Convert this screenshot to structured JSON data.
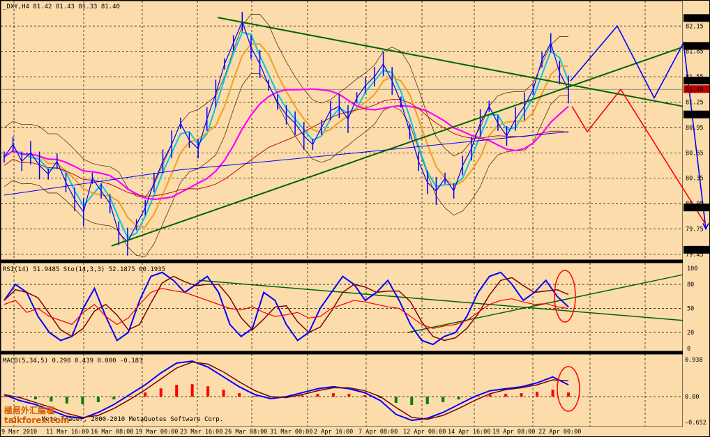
{
  "colors": {
    "background": "#fbdcaa",
    "frame": "#000000",
    "grid": "#000000",
    "price_line": "#0000ff",
    "ma_fast": "#00c8e0",
    "ma_mid": "#f0a020",
    "ma_slow": "#ff00ff",
    "ma_long": "#c01010",
    "ma_longest": "#0000ff",
    "bands": "#5a3010",
    "trend": "#006400",
    "forecast_blue": "#0000ff",
    "forecast_red": "#ff0000",
    "rsi": "#ff0000",
    "stoch_main": "#0000ff",
    "stoch_signal": "#800000",
    "macd_pos": "#ff0000",
    "macd_neg": "#008000",
    "ellipse": "#ff0000",
    "tag_bg": "#000000",
    "tag_fg": "#ffffff"
  },
  "main_header": "_DXY,H4 81.42 81.43 81.33 81.40",
  "rsi_header": "RSI(14) 51.9485  Sto(14,3,3) 52.1875 60.1935",
  "macd_header": "MACD(5,34,5) 0.298 0.439 0.000 -0.183",
  "overlay_text_1": "Meta Trader, 2000-2010 MetaQuotes Software Corp.",
  "watermark_line1": "極易外汇論壇",
  "watermark_line2": "taikforex.com",
  "x_labels": [
    "9 Mar 2010",
    "11 Mar 16:00",
    "16 Mar 08:00",
    "19 Mar 00:00",
    "23 Mar 16:00",
    "26 Mar 08:00",
    "31 Mar 00:00",
    "2 Apr 16:00",
    "7 Apr 08:00",
    "12 Apr 00:00",
    "14 Apr 16:00",
    "19 Apr 08:00",
    "22 Apr 00:00"
  ],
  "price_axis": {
    "labels": [
      "82.15",
      "81.85",
      "81.55",
      "81.25",
      "80.95",
      "80.65",
      "80.35",
      "80.05",
      "79.75",
      "79.45"
    ],
    "tags_dark": [
      "82.24",
      "81.91",
      "81.50",
      "81.10",
      "80.00",
      "79.50"
    ],
    "tag_red": "81.40",
    "ylim": [
      79.4,
      82.35
    ]
  },
  "rsi_axis": {
    "labels": [
      "100",
      "80",
      "50",
      "20",
      "0"
    ],
    "ylim": [
      0,
      100
    ]
  },
  "macd_axis": {
    "labels": [
      "0.938",
      "0.00",
      "-0.652"
    ],
    "ylim": [
      -0.652,
      0.938
    ]
  },
  "chart_data": [
    {
      "type": "candlestick",
      "title": "_DXY,H4 81.42 81.43 81.33 81.40",
      "symbol": "_DXY",
      "timeframe": "H4",
      "last": {
        "open": 81.42,
        "high": 81.43,
        "low": 81.33,
        "close": 81.4
      },
      "ylim": [
        79.4,
        82.35
      ],
      "x_labels": [
        "9 Mar 2010",
        "11 Mar 16:00",
        "16 Mar 08:00",
        "19 Mar 00:00",
        "23 Mar 16:00",
        "26 Mar 08:00",
        "31 Mar 00:00",
        "2 Apr 16:00",
        "7 Apr 08:00",
        "12 Apr 00:00",
        "14 Apr 16:00",
        "19 Apr 08:00",
        "22 Apr 00:00"
      ],
      "close_path": [
        80.6,
        80.75,
        80.55,
        80.65,
        80.5,
        80.4,
        80.55,
        80.3,
        80.1,
        79.95,
        80.35,
        80.2,
        80.05,
        79.7,
        79.6,
        79.8,
        80.0,
        80.3,
        80.55,
        80.75,
        81.0,
        80.8,
        80.7,
        81.05,
        81.35,
        81.7,
        81.95,
        82.2,
        81.9,
        81.7,
        81.45,
        81.25,
        81.1,
        81.0,
        80.85,
        80.75,
        80.95,
        81.15,
        81.2,
        81.05,
        81.3,
        81.45,
        81.55,
        81.7,
        81.5,
        81.25,
        80.9,
        80.55,
        80.3,
        80.2,
        80.35,
        80.2,
        80.5,
        80.7,
        81.0,
        81.2,
        81.0,
        80.85,
        81.05,
        81.2,
        81.4,
        81.75,
        81.95,
        81.6,
        81.4
      ],
      "trendlines": [
        {
          "from": [
            "23 Mar 16:00",
            82.25
          ],
          "to": [
            "right edge",
            81.2
          ]
        },
        {
          "from": [
            "16 Mar 08:00",
            79.55
          ],
          "to": [
            "right edge",
            81.9
          ]
        }
      ],
      "forecast_blue": [
        81.5,
        82.15,
        81.3,
        81.95,
        79.75
      ],
      "forecast_red": [
        81.2,
        80.9,
        81.4,
        79.8
      ]
    },
    {
      "type": "line",
      "title": "RSI(14) 51.9485  Sto(14,3,3) 52.1875 60.1935",
      "ylim": [
        0,
        100
      ],
      "series": [
        {
          "name": "RSI(14)",
          "last": 51.9485,
          "values": [
            55,
            60,
            45,
            50,
            40,
            35,
            30,
            45,
            55,
            40,
            30,
            38,
            55,
            70,
            75,
            72,
            70,
            65,
            60,
            55,
            50,
            48,
            52,
            45,
            40,
            42,
            45,
            38,
            40,
            50,
            55,
            60,
            58,
            55,
            52,
            50,
            40,
            30,
            25,
            28,
            30,
            35,
            45,
            55,
            60,
            62,
            58,
            55,
            56,
            52,
            50
          ]
        },
        {
          "name": "Sto(14,3,3)",
          "last": 52.1875,
          "values": [
            60,
            80,
            70,
            40,
            20,
            10,
            15,
            50,
            75,
            40,
            10,
            20,
            60,
            90,
            95,
            85,
            70,
            80,
            90,
            70,
            30,
            15,
            25,
            70,
            60,
            30,
            10,
            20,
            50,
            70,
            90,
            80,
            60,
            70,
            85,
            60,
            30,
            10,
            5,
            15,
            20,
            40,
            70,
            90,
            95,
            80,
            60,
            70,
            85,
            65,
            52
          ]
        },
        {
          "name": "Sto signal",
          "last": 60.1935
        }
      ]
    },
    {
      "type": "bar",
      "title": "MACD(5,34,5) 0.298 0.439 0.000 -0.183",
      "ylim": [
        -0.652,
        0.938
      ],
      "series": [
        {
          "name": "MACD",
          "last": 0.298,
          "values": [
            0.05,
            -0.1,
            -0.2,
            -0.35,
            -0.5,
            -0.55,
            -0.4,
            -0.2,
            0.05,
            0.3,
            0.6,
            0.85,
            0.9,
            0.75,
            0.5,
            0.25,
            0.05,
            -0.05,
            0.0,
            0.1,
            0.2,
            0.25,
            0.2,
            0.1,
            -0.1,
            -0.45,
            -0.6,
            -0.55,
            -0.4,
            -0.2,
            0.0,
            0.15,
            0.2,
            0.25,
            0.35,
            0.5,
            0.3
          ]
        },
        {
          "name": "Signal",
          "last": 0.439
        }
      ]
    }
  ]
}
